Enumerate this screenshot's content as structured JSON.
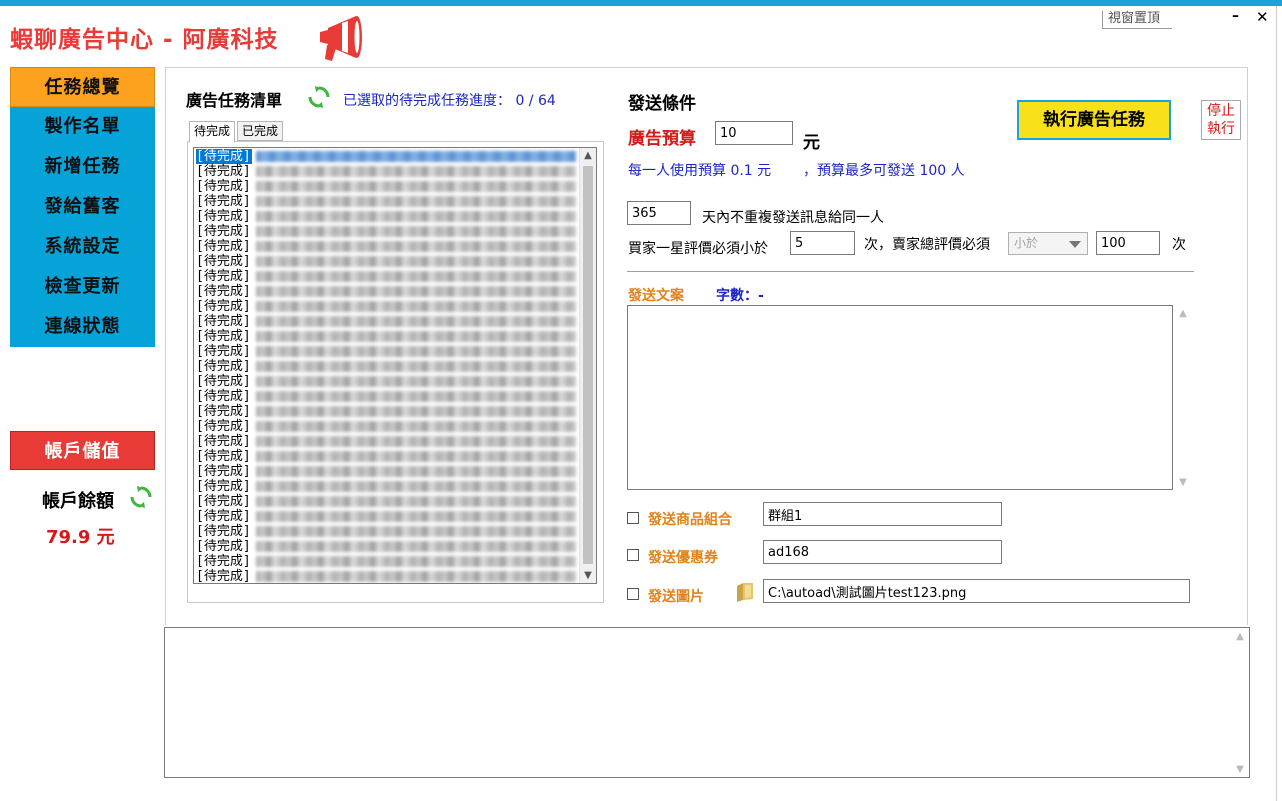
{
  "app": {
    "title": "蝦聊廣告中心 - 阿廣科技",
    "pin_label": "視窗置頂",
    "minimize_label": "–",
    "close_label": "✕",
    "accent_color": "#1aa3d9"
  },
  "nav": {
    "items": [
      {
        "label": "任務總覽"
      },
      {
        "label": "製作名單"
      },
      {
        "label": "新增任務"
      },
      {
        "label": "發給舊客"
      },
      {
        "label": "系統設定"
      },
      {
        "label": "檢查更新"
      },
      {
        "label": "連線狀態"
      }
    ]
  },
  "account": {
    "recharge_label": "帳戶儲值",
    "balance_label": "帳戶餘額",
    "balance_value": "79.9 元"
  },
  "tasks": {
    "title": "廣告任務清單",
    "progress_text": "已選取的待完成任務進度： 0 / 64",
    "tabs": [
      {
        "label": "待完成"
      },
      {
        "label": "已完成"
      }
    ],
    "row_tag": "[待完成]"
  },
  "send": {
    "title": "發送條件",
    "budget_label": "廣告預算",
    "budget_value": "10",
    "unit": "元",
    "budget_per_person": "每一人使用預算 0.1 元",
    "budget_max": "，預算最多可發送 100 人",
    "execute_label": "執行廣告任務",
    "stop_label_line1": "停止",
    "stop_label_line2": "執行",
    "days_value": "365",
    "days_label": "天內不重複發送訊息給同一人",
    "rating_prefix": "買家一星評價必須小於",
    "rating_value": "5",
    "rating_mid": "次，賣家總評價必須",
    "compare_selected": "小於",
    "total_rating_value": "100",
    "rating_suffix": "次",
    "copy_label": "發送文案",
    "word_count_label": "字數：-",
    "options": [
      {
        "label": "發送商品組合",
        "value": "群組1"
      },
      {
        "label": "發送優惠券",
        "value": "ad168"
      },
      {
        "label": "發送圖片",
        "value": "C:\\autoad\\測試圖片test123.png"
      }
    ]
  }
}
